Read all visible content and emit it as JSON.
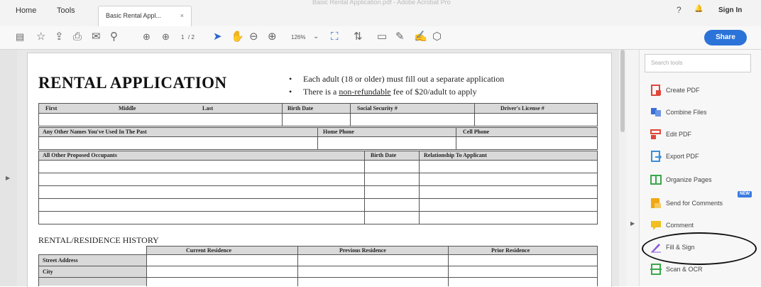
{
  "window_title": "Basic Rental Application.pdf - Adobe Acrobat Pro",
  "tabs": {
    "home": "Home",
    "tools": "Tools",
    "document": "Basic Rental Appl...",
    "close_glyph": "×"
  },
  "header_right": {
    "help_icon": "?",
    "bell_icon": "🔔",
    "sign_in": "Sign In"
  },
  "toolbar": {
    "page_current": "1",
    "page_total": "/ 2",
    "zoom": "126%",
    "share_label": "Share"
  },
  "tools_panel": {
    "search_placeholder": "Search tools",
    "items": [
      {
        "label": "Create PDF",
        "color": "#e0453a"
      },
      {
        "label": "Combine Files",
        "color": "#3a6fd8"
      },
      {
        "label": "Edit PDF",
        "color": "#e0453a"
      },
      {
        "label": "Export PDF",
        "color": "#3a8fd8"
      },
      {
        "label": "Organize Pages",
        "color": "#3aa84a"
      },
      {
        "label": "Send for Comments",
        "color": "#f0a810"
      },
      {
        "label": "Comment",
        "color": "#f0c020"
      },
      {
        "label": "Fill & Sign",
        "color": "#8a5ad8"
      },
      {
        "label": "Scan & OCR",
        "color": "#3aa84a"
      }
    ],
    "new_badge": "NEW"
  },
  "document": {
    "title": "RENTAL APPLICATION",
    "bullets": [
      {
        "pre": "Each adult (18 or older) must fill out a separate application",
        "link": "",
        "post": ""
      },
      {
        "pre": "There is a ",
        "link": "non-refundable",
        "post": " fee of $20/adult to apply"
      }
    ],
    "row1": [
      "First",
      "Middle",
      "Last",
      "Birth Date",
      "Social Security #",
      "Driver's License #"
    ],
    "row2": [
      "Any Other Names You've Used In The Past",
      "Home Phone",
      "Cell Phone"
    ],
    "row3": [
      "All Other Proposed Occupants",
      "Birth Date",
      "Relationship To Applicant"
    ],
    "history_title": "RENTAL/RESIDENCE HISTORY",
    "history_headers": [
      "Current Residence",
      "Previous Residence",
      "Prior Residence"
    ],
    "history_rows": [
      "Street Address",
      "City"
    ]
  }
}
